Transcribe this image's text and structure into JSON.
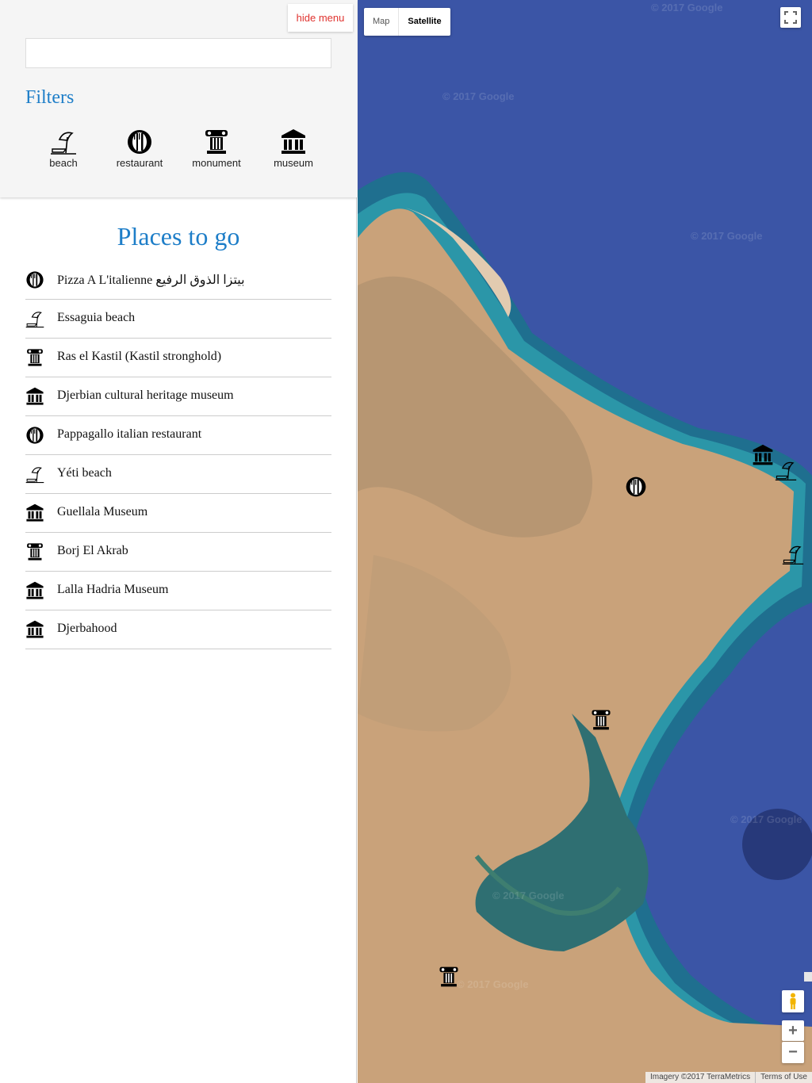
{
  "sidebar": {
    "hide_menu_label": "hide menu",
    "search": {
      "value": "",
      "placeholder": ""
    },
    "filters_title": "Filters",
    "filters": [
      {
        "label": "beach",
        "icon": "beach-icon"
      },
      {
        "label": "restaurant",
        "icon": "restaurant-icon"
      },
      {
        "label": "monument",
        "icon": "monument-icon"
      },
      {
        "label": "museum",
        "icon": "museum-icon"
      }
    ],
    "places_title": "Places to go",
    "places": [
      {
        "name": "Pizza A L'italienne بيتزا الذوق الرفيع",
        "category": "restaurant"
      },
      {
        "name": "Essaguia beach",
        "category": "beach"
      },
      {
        "name": "Ras el Kastil (Kastil stronghold)",
        "category": "monument"
      },
      {
        "name": "Djerbian cultural heritage museum",
        "category": "museum"
      },
      {
        "name": "Pappagallo italian restaurant",
        "category": "restaurant"
      },
      {
        "name": "Yéti beach",
        "category": "beach"
      },
      {
        "name": "Guellala Museum",
        "category": "museum"
      },
      {
        "name": "Borj El Akrab",
        "category": "monument"
      },
      {
        "name": "Lalla Hadria Museum",
        "category": "museum"
      },
      {
        "name": "Djerbahood",
        "category": "museum"
      }
    ]
  },
  "map": {
    "map_type_options": [
      "Map",
      "Satellite"
    ],
    "selected_map_type": "Satellite",
    "watermark": "© 2017 Google",
    "zoom_in_label": "+",
    "zoom_out_label": "−",
    "attribution": "Imagery ©2017 TerraMetrics",
    "terms_label": "Terms of Use",
    "markers": [
      {
        "category": "museum"
      },
      {
        "category": "beach"
      },
      {
        "category": "restaurant"
      },
      {
        "category": "beach"
      },
      {
        "category": "monument"
      },
      {
        "category": "monument"
      }
    ]
  },
  "colors": {
    "accent": "#1e7ec8",
    "hide_menu": "#e0332f",
    "sea": "#3b55a6",
    "land": "#c9a27a"
  }
}
